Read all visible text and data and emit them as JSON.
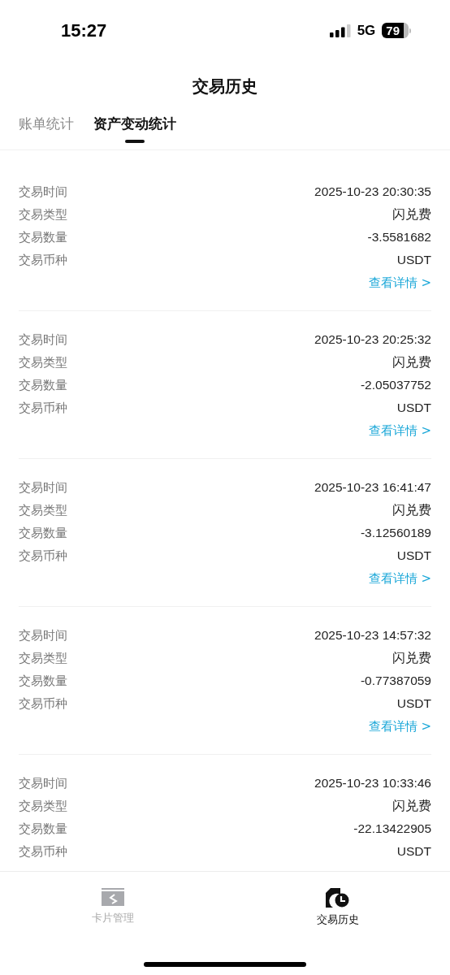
{
  "status_bar": {
    "time": "15:27",
    "network": "5G",
    "battery": "79"
  },
  "header": {
    "title": "交易历史"
  },
  "tabs": [
    {
      "label": "账单统计",
      "selected": false
    },
    {
      "label": "资产变动统计",
      "selected": true
    }
  ],
  "records": [
    {
      "fields": [
        {
          "label": "交易时间",
          "value": "2025-10-23 20:30:35"
        },
        {
          "label": "交易类型",
          "value": "闪兑费"
        },
        {
          "label": "交易数量",
          "value": "-3.5581682"
        },
        {
          "label": "交易币种",
          "value": "USDT"
        }
      ],
      "link": "查看详情 >"
    },
    {
      "fields": [
        {
          "label": "交易时间",
          "value": "2025-10-23 20:25:32"
        },
        {
          "label": "交易类型",
          "value": "闪兑费"
        },
        {
          "label": "交易数量",
          "value": "-2.05037752"
        },
        {
          "label": "交易币种",
          "value": "USDT"
        }
      ],
      "link": "查看详情 >"
    },
    {
      "fields": [
        {
          "label": "交易时间",
          "value": "2025-10-23 16:41:47"
        },
        {
          "label": "交易类型",
          "value": "闪兑费"
        },
        {
          "label": "交易数量",
          "value": "-3.12560189"
        },
        {
          "label": "交易币种",
          "value": "USDT"
        }
      ],
      "link": "查看详情 >"
    },
    {
      "fields": [
        {
          "label": "交易时间",
          "value": "2025-10-23 14:57:32"
        },
        {
          "label": "交易类型",
          "value": "闪兑费"
        },
        {
          "label": "交易数量",
          "value": "-0.77387059"
        },
        {
          "label": "交易币种",
          "value": "USDT"
        }
      ],
      "link": "查看详情 >"
    },
    {
      "fields": [
        {
          "label": "交易时间",
          "value": "2025-10-23 10:33:46"
        },
        {
          "label": "交易类型",
          "value": "闪兑费"
        },
        {
          "label": "交易数量",
          "value": "-22.13422905"
        },
        {
          "label": "交易币种",
          "value": "USDT"
        }
      ]
    }
  ],
  "bottom_nav": [
    {
      "kind": "cards",
      "label": "卡片管理",
      "selected": false
    },
    {
      "kind": "history",
      "label": "交易历史",
      "selected": true
    }
  ]
}
